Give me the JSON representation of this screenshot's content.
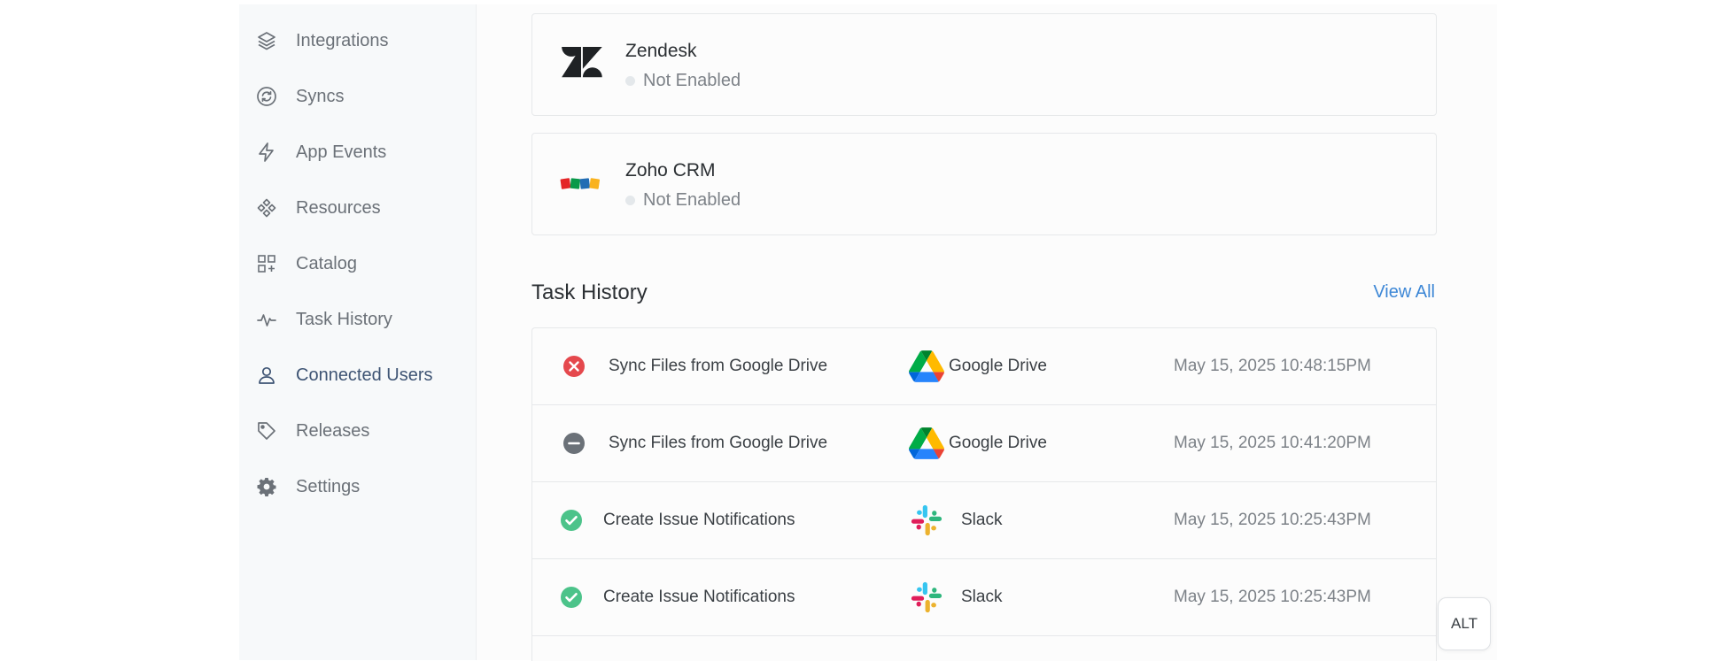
{
  "sidebar": {
    "items": [
      {
        "label": "Integrations",
        "icon": "layers-icon",
        "active": false
      },
      {
        "label": "Syncs",
        "icon": "sync-icon",
        "active": false
      },
      {
        "label": "App Events",
        "icon": "lightning-icon",
        "active": false
      },
      {
        "label": "Resources",
        "icon": "resources-icon",
        "active": false
      },
      {
        "label": "Catalog",
        "icon": "catalog-icon",
        "active": false
      },
      {
        "label": "Task History",
        "icon": "activity-icon",
        "active": false
      },
      {
        "label": "Connected Users",
        "icon": "user-icon",
        "active": true
      },
      {
        "label": "Releases",
        "icon": "tag-icon",
        "active": false
      },
      {
        "label": "Settings",
        "icon": "gear-icon",
        "active": false
      }
    ]
  },
  "integrations": [
    {
      "name": "Zendesk",
      "status": "Not Enabled",
      "logo": "zendesk-logo"
    },
    {
      "name": "Zoho CRM",
      "status": "Not Enabled",
      "logo": "zoho-logo"
    }
  ],
  "task_history": {
    "title": "Task History",
    "view_all_label": "View All",
    "rows": [
      {
        "status": "error",
        "name": "Sync Files from Google Drive",
        "app": "Google Drive",
        "time": "May 15, 2025 10:48:15PM"
      },
      {
        "status": "canceled",
        "name": "Sync Files from Google Drive",
        "app": "Google Drive",
        "time": "May 15, 2025 10:41:20PM"
      },
      {
        "status": "success",
        "name": "Create Issue Notifications",
        "app": "Slack",
        "time": "May 15, 2025 10:25:43PM"
      },
      {
        "status": "success",
        "name": "Create Issue Notifications",
        "app": "Slack",
        "time": "May 15, 2025 10:25:43PM"
      }
    ]
  },
  "alt_button": {
    "label": "ALT"
  },
  "colors": {
    "accent": "#3d87d6",
    "active_nav": "#3e5474",
    "error": "#e5484d",
    "success": "#4cc38a",
    "neutral": "#6b7178"
  }
}
